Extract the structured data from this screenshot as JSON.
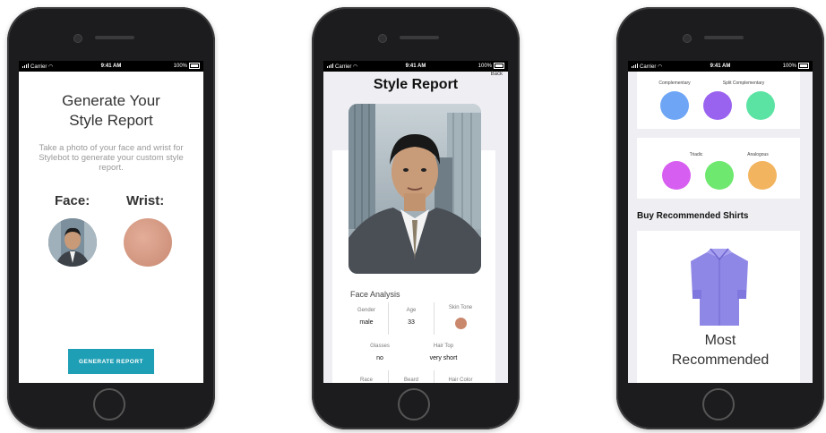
{
  "status_bar": {
    "carrier": "Carrier",
    "time": "9:41 AM",
    "battery": "100%"
  },
  "screen1": {
    "title_line1": "Generate Your",
    "title_line2": "Style Report",
    "description": "Take a photo of your face and wrist for Stylebot to generate your custom style report.",
    "face_label": "Face:",
    "wrist_label": "Wrist:",
    "generate_button": "GENERATE REPORT",
    "button_color": "#1f9fb5"
  },
  "screen2": {
    "back_label": "Back",
    "title": "Style Report",
    "section_title": "Face Analysis",
    "gender_label": "Gender",
    "gender_value": "male",
    "age_label": "Age",
    "age_value": "33",
    "skin_tone_label": "Skin Tone",
    "skin_tone_color": "#c9876b",
    "glasses_label": "Glasses",
    "glasses_value": "no",
    "hair_top_label": "Hair Top",
    "hair_top_value": "very short",
    "race_label": "Race",
    "beard_label": "Beard",
    "hair_color_label": "Hair Color"
  },
  "screen3": {
    "complementary_label": "Complementary",
    "split_complementary_label": "Split Complementary",
    "triadic_label": "Triadic",
    "analogous_label": "Analogous",
    "palette_row1": [
      "#6ea6f5",
      "#9a63ef",
      "#5be3a3"
    ],
    "palette_row2": [
      "#d65ef0",
      "#6ee86e",
      "#f2b45e"
    ],
    "buy_title": "Buy Recommended Shirts",
    "shirt_label_line1": "Most",
    "shirt_label_line2": "Recommended",
    "shirt_color": "#8f87e6"
  }
}
